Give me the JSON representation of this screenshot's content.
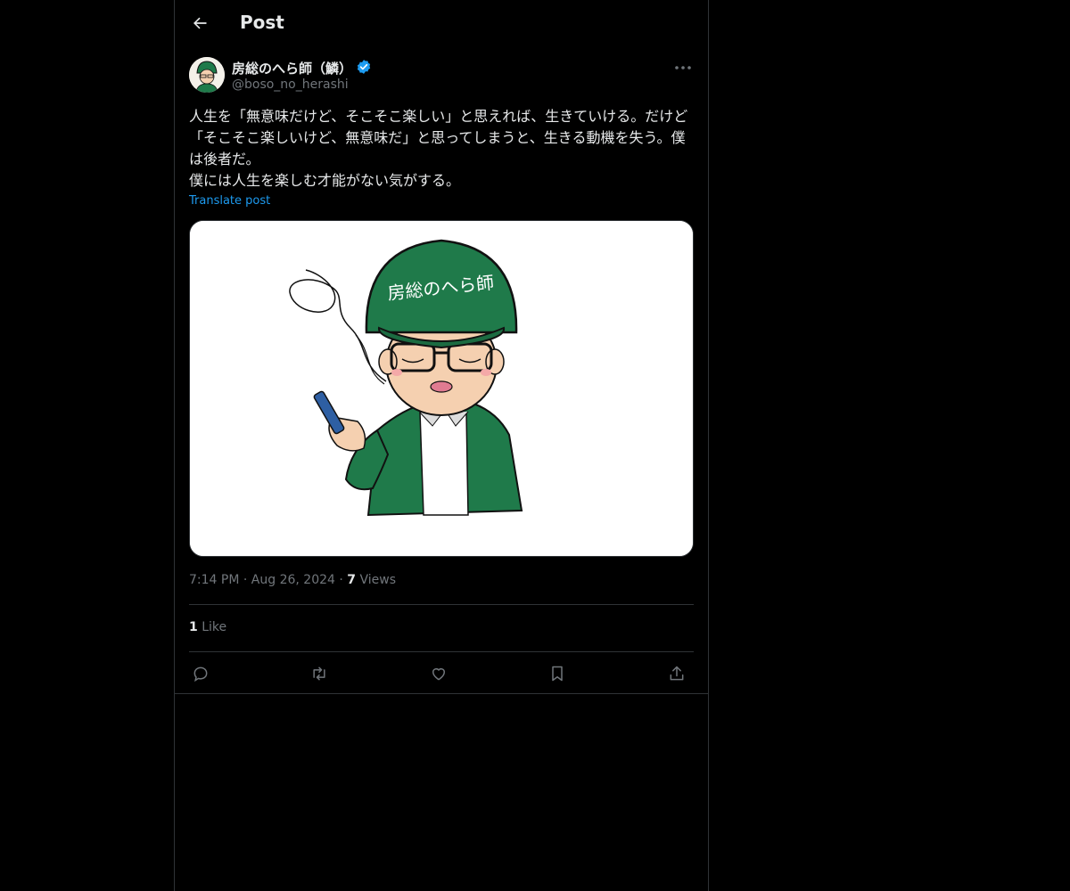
{
  "header": {
    "title": "Post",
    "back_icon": "arrow-left-icon"
  },
  "author": {
    "display_name": "房総のへら師（鱗）",
    "handle": "@boso_no_herashi",
    "verified": true,
    "verified_color": "#1d9bf0"
  },
  "post": {
    "text": "人生を「無意味だけど、そこそこ楽しい」と思えれば、生きていける。だけど「そこそこ楽しいけど、無意味だ」と思ってしまうと、生きる動機を失う。僕は後者だ。\n僕には人生を楽しむ才能がない気がする。",
    "translate_label": "Translate post",
    "image": {
      "cap_text": "房総のへら師"
    }
  },
  "meta": {
    "time": "7:14 PM",
    "separator": "·",
    "date": "Aug 26, 2024",
    "views_count": "7",
    "views_label": "Views"
  },
  "stats": {
    "likes_count": "1",
    "likes_label": "Like"
  },
  "actions": [
    "reply-icon",
    "repost-icon",
    "like-icon",
    "bookmark-icon",
    "share-icon"
  ],
  "colors": {
    "accent": "#1d9bf0",
    "text": "#e7e9ea",
    "secondary": "#71767b",
    "border": "#2f3336",
    "cap_green": "#1f7a4a"
  }
}
